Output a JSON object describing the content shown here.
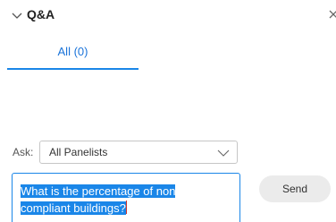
{
  "header": {
    "title": "Q&A",
    "collapse_icon": "chevron-down-icon",
    "close_icon": "close-icon"
  },
  "tabs": [
    {
      "label": "All (0)",
      "selected": true
    }
  ],
  "ask": {
    "label": "Ask:",
    "selected": "All Panelists"
  },
  "question": {
    "line1": "What is the percentage of non",
    "line2": "compliant buildings?"
  },
  "send": {
    "label": "Send"
  },
  "colors": {
    "accent": "#1a86e8",
    "tab_text": "#1a73d9",
    "send_bg": "#ebebeb",
    "caret": "#d0362b"
  }
}
